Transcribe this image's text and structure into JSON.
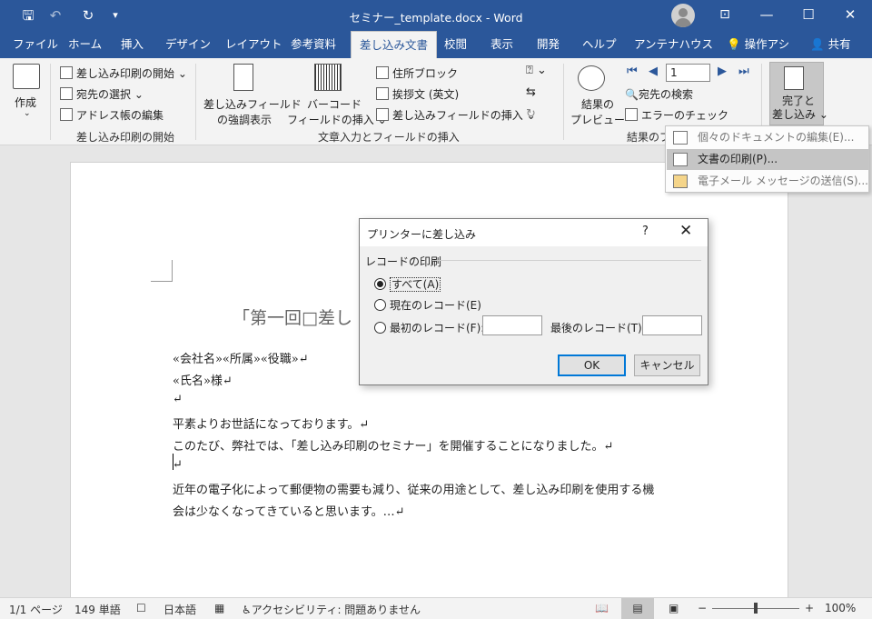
{
  "titlebar": {
    "title": "セミナー_template.docx  -  Word",
    "qa_save": "🖫",
    "qa_undo": "↶",
    "qa_redo": "↻",
    "qa_customize": "▾",
    "options": "⊡",
    "minimize": "—",
    "maximize": "☐",
    "close": "✕"
  },
  "tabs": [
    "ファイル",
    "ホーム",
    "挿入",
    "デザイン",
    "レイアウト",
    "参考資料",
    "差し込み文書",
    "校閲",
    "表示",
    "開発",
    "ヘルプ",
    "アンテナハウス",
    "操作アシ",
    "共有"
  ],
  "tabs_active": "差し込み文書",
  "ribbon": {
    "create": "作成",
    "start_merge": "差し込み印刷の開始",
    "select_recipients": "宛先の選択",
    "edit_address": "アドレス帳の編集",
    "group1": "差し込み印刷の開始",
    "highlight_fields_1": "差し込みフィールド",
    "highlight_fields_2": "の強調表示",
    "barcode_1": "バーコード",
    "barcode_2": "フィールドの挿入",
    "address_block": "住所ブロック",
    "greeting_line": "挨拶文 (英文)",
    "insert_merge_field": "差し込みフィールドの挿入",
    "group2": "文章入力とフィールドの挿入",
    "preview_1": "結果の",
    "preview_2": "プレビュー",
    "record_number": "1",
    "find_recipient": "宛先の検索",
    "check_errors": "エラーのチェック",
    "group3": "結果のプ",
    "finish_1": "完了と",
    "finish_2": "差し込み"
  },
  "dropdown": {
    "items": [
      "個々のドキュメントの編集(E)...",
      "文書の印刷(P)...",
      "電子メール メッセージの送信(S)..."
    ],
    "selected_index": 1
  },
  "dialog": {
    "title": "プリンターに差し込み",
    "help": "?",
    "close": "✕",
    "group": "レコードの印刷",
    "all": "すべて(A)",
    "current": "現在のレコード(E)",
    "from": "最初のレコード(F):",
    "to": "最後のレコード(T):",
    "from_value": "",
    "to_value": "",
    "selected": "all",
    "ok": "OK",
    "cancel": "キャンセル"
  },
  "document": {
    "heading": "「第一回□差し",
    "line1": "«会社名»«所属»«役職»↵",
    "line2": "«氏名»様↵",
    "line3": "↵",
    "line4": "平素よりお世話になっております。↵",
    "line5": "このたび、弊社では、「差し込み印刷のセミナー」を開催することになりました。↵",
    "line6": "↵",
    "line7": "近年の電子化によって郵便物の需要も減り、従来の用途として、差し込み印刷を使用する機",
    "line8": "会は少なくなってきていると思います。…↵"
  },
  "statusbar": {
    "page": "1/1 ページ",
    "words": "149 単語",
    "language": "日本語",
    "accessibility": "アクセシビリティ: 問題ありません",
    "zoom_minus": "−",
    "zoom_plus": "+",
    "zoom": "100%"
  }
}
